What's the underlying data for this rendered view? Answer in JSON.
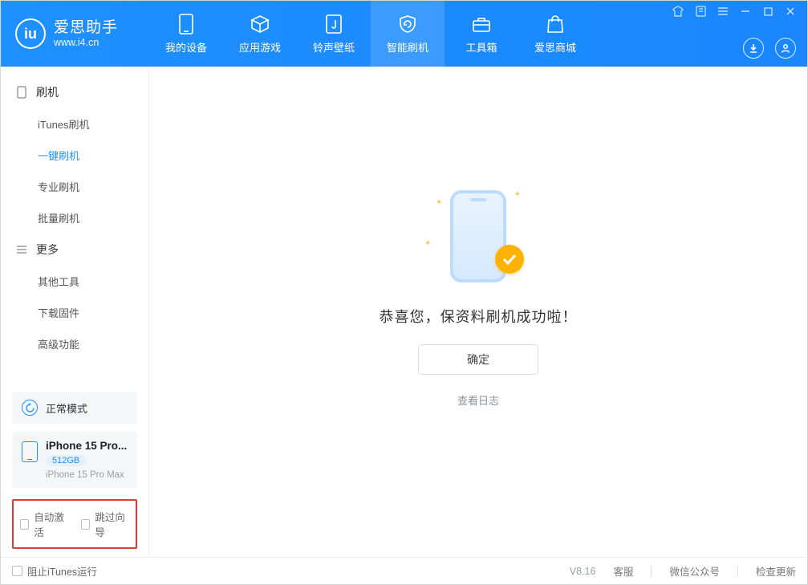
{
  "app": {
    "name_cn": "爱思助手",
    "name_en": "www.i4.cn"
  },
  "tabs": [
    {
      "id": "device",
      "label": "我的设备"
    },
    {
      "id": "apps",
      "label": "应用游戏"
    },
    {
      "id": "ringwall",
      "label": "铃声壁纸"
    },
    {
      "id": "flash",
      "label": "智能刷机"
    },
    {
      "id": "tools",
      "label": "工具箱"
    },
    {
      "id": "mall",
      "label": "爱思商城"
    }
  ],
  "active_tab": "flash",
  "sidebar": {
    "group_flash": {
      "title": "刷机",
      "items": [
        {
          "id": "itunes",
          "label": "iTunes刷机"
        },
        {
          "id": "onekey",
          "label": "一键刷机"
        },
        {
          "id": "pro",
          "label": "专业刷机"
        },
        {
          "id": "batch",
          "label": "批量刷机"
        }
      ],
      "active": "onekey"
    },
    "group_more": {
      "title": "更多",
      "items": [
        {
          "id": "other",
          "label": "其他工具"
        },
        {
          "id": "dlfw",
          "label": "下载固件"
        },
        {
          "id": "adv",
          "label": "高级功能"
        }
      ]
    },
    "status": {
      "label": "正常模式"
    },
    "device": {
      "name": "iPhone 15 Pro...",
      "capacity": "512GB",
      "model": "iPhone 15 Pro Max"
    },
    "opts": {
      "auto_activate": "自动激活",
      "skip_wizard": "跳过向导"
    }
  },
  "main": {
    "message": "恭喜您，保资料刷机成功啦！",
    "ok": "确定",
    "view_log": "查看日志"
  },
  "footer": {
    "block_itunes": "阻止iTunes运行",
    "version": "V8.16",
    "links": [
      "客服",
      "微信公众号",
      "检查更新"
    ]
  }
}
